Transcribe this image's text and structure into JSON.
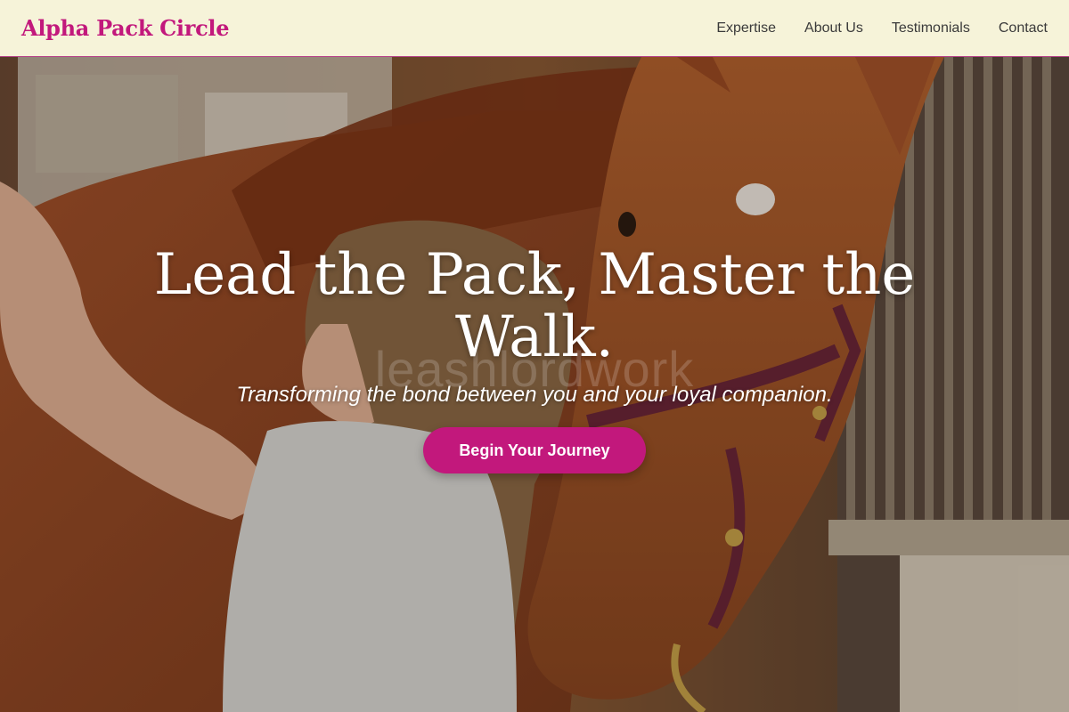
{
  "brand": {
    "name": "Alpha Pack Circle"
  },
  "nav": {
    "links": [
      "Expertise",
      "About Us",
      "Testimonials",
      "Contact"
    ]
  },
  "hero": {
    "title": "Lead the Pack, Master the Walk.",
    "watermark": "leashlordwork",
    "subtitle": "Transforming the bond between you and your loyal companion.",
    "cta_label": "Begin Your Journey"
  },
  "colors": {
    "accent": "#c2187c",
    "navbar_bg": "#f6f3d9",
    "nav_text": "#3a3a3a",
    "hero_text": "#ffffff"
  }
}
